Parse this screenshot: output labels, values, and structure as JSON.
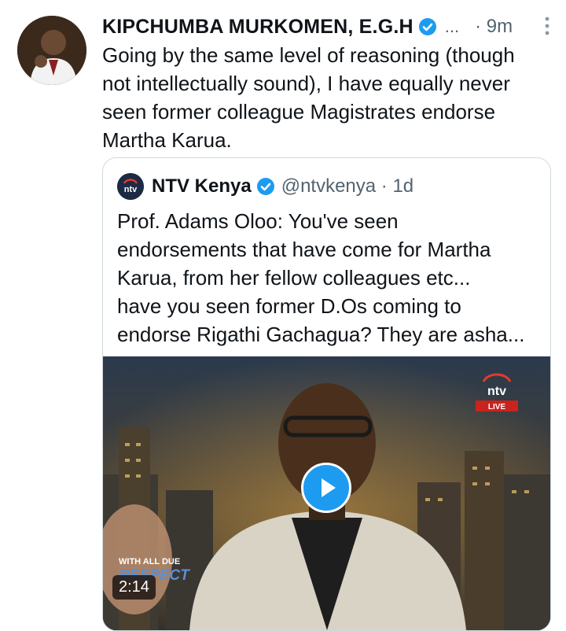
{
  "tweet": {
    "author_name": "KIPCHUMBA MURKOMEN, E.G.H",
    "ellipsis": "...",
    "time": "· 9m",
    "text": "Going by the same level of reasoning (though\nnot intellectually sound), I have equally never\nseen former colleague Magistrates endorse\nMartha Karua.",
    "icons": {
      "verified": "verified-badge-icon",
      "more": "more-vertical-icon"
    },
    "accent_color": "#1d9bf0"
  },
  "quoted_tweet": {
    "author_name": "NTV Kenya",
    "handle_time": "@ntvkenya · 1d",
    "text": "Prof. Adams Oloo: You've seen\nendorsements that have come for Martha\nKarua, from her fellow colleagues etc...\nhave you seen former D.Os coming to\nendorse Rigathi Gachagua? They are asha...",
    "video": {
      "duration": "2:14",
      "channel_logo_text": "ntv",
      "live_label": "LIVE",
      "show_title_line1": "WITH ALL DUE",
      "show_title_line2": "RESPECT"
    }
  }
}
